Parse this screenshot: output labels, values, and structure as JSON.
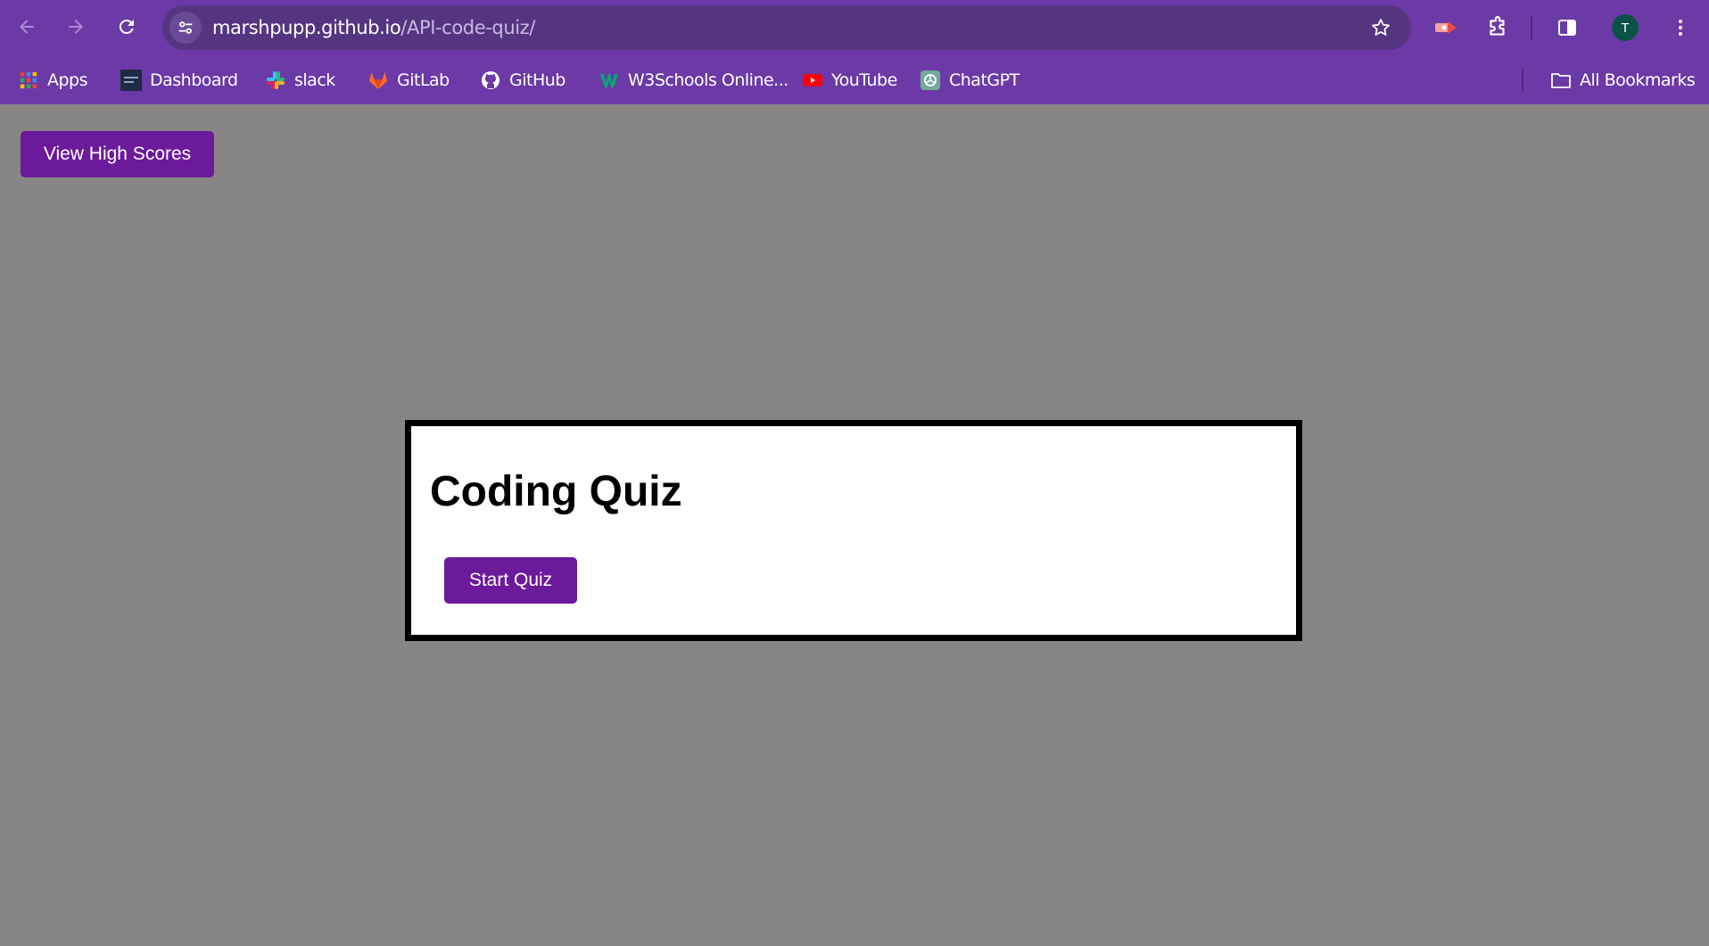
{
  "browser": {
    "url_host": "marshpupp.github.io",
    "url_path": "/API-code-quiz/",
    "profile_initial": "T",
    "colors": {
      "chrome": "#6b3aa6",
      "omnibox": "#553580"
    }
  },
  "bookmarks": [
    {
      "label": "Apps",
      "icon": "apps-grid-icon"
    },
    {
      "label": "Dashboard",
      "icon": "dashboard-favicon"
    },
    {
      "label": "slack",
      "icon": "slack-icon"
    },
    {
      "label": "GitLab",
      "icon": "gitlab-icon"
    },
    {
      "label": "GitHub",
      "icon": "github-icon"
    },
    {
      "label": "W3Schools Online...",
      "icon": "w3schools-icon"
    },
    {
      "label": "YouTube",
      "icon": "youtube-icon"
    },
    {
      "label": "ChatGPT",
      "icon": "chatgpt-icon"
    }
  ],
  "all_bookmarks_label": "All Bookmarks",
  "page": {
    "high_scores_label": "View High Scores",
    "title": "Coding Quiz",
    "start_label": "Start Quiz",
    "colors": {
      "background": "#878685",
      "button": "#6c1a9c",
      "card": "#ffffff"
    }
  }
}
